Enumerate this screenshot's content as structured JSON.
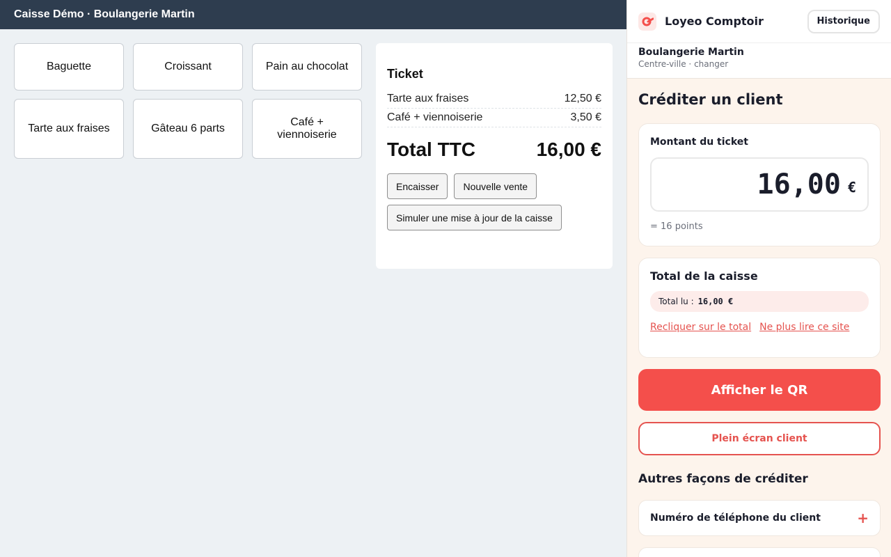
{
  "pos": {
    "title": "Caisse Démo · Boulangerie Martin",
    "products": [
      "Baguette",
      "Croissant",
      "Pain au chocolat",
      "Tarte aux fraises",
      "Gâteau 6 parts",
      "Café + viennoiserie"
    ],
    "ticket": {
      "title": "Ticket",
      "lines": [
        {
          "name": "Tarte aux fraises",
          "price": "12,50 €"
        },
        {
          "name": "Café + viennoiserie",
          "price": "3,50 €"
        }
      ],
      "total_label": "Total TTC",
      "total_value": "16,00 €"
    },
    "buttons": {
      "checkout": "Encaisser",
      "new_sale": "Nouvelle vente",
      "simulate": "Simuler une mise à jour de la caisse"
    }
  },
  "panel": {
    "brand": "Loyeo Comptoir",
    "history_button": "Historique",
    "store_name": "Boulangerie Martin",
    "store_sub": "Centre-ville · changer",
    "title": "Créditer un client",
    "amount_card": {
      "label": "Montant du ticket",
      "value": "16,00",
      "currency": "€",
      "points": "= 16 points"
    },
    "register_card": {
      "label": "Total de la caisse",
      "read_label": "Total lu :",
      "read_value": "16,00 €",
      "reclick_link": "Recliquer sur le total",
      "stop_link": "Ne plus lire ce site"
    },
    "qr_button": "Afficher le QR",
    "fullscreen_button": "Plein écran client",
    "other_title": "Autres façons de créditer",
    "phone_option": "Numéro de téléphone du client",
    "accent_color": "#f44f4b"
  }
}
